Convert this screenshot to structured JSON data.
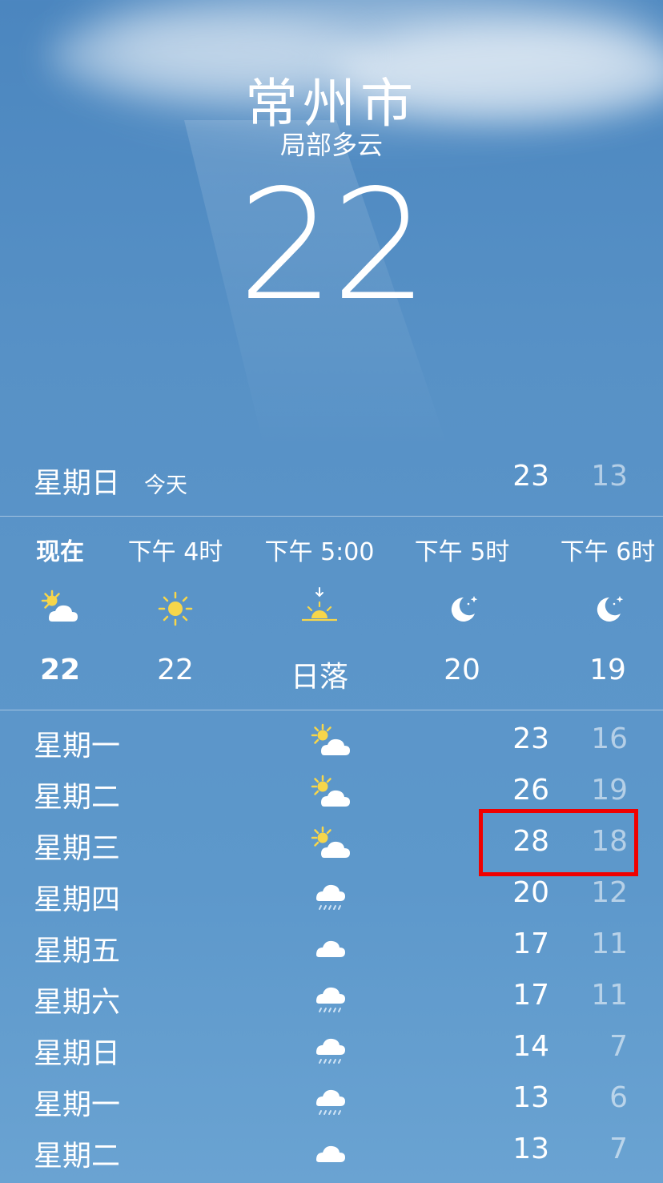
{
  "location": {
    "city": "常州市",
    "condition": "局部多云",
    "temperature": "22"
  },
  "today": {
    "day": "星期日",
    "tag": "今天",
    "high": "23",
    "low": "13"
  },
  "hourly": [
    {
      "label": "现在",
      "icon": "partly-cloudy-icon",
      "temp": "22",
      "bold": true
    },
    {
      "label": "下午 4时",
      "icon": "sun-icon",
      "temp": "22"
    },
    {
      "label": "下午 5:00",
      "icon": "sunset-icon",
      "temp": "日落"
    },
    {
      "label": "下午 5时",
      "icon": "moon-icon",
      "temp": "20"
    },
    {
      "label": "下午 6时",
      "icon": "moon-icon",
      "temp": "19"
    }
  ],
  "daily": [
    {
      "day": "星期一",
      "icon": "partly-cloudy-icon",
      "high": "23",
      "low": "16"
    },
    {
      "day": "星期二",
      "icon": "partly-cloudy-icon",
      "high": "26",
      "low": "19"
    },
    {
      "day": "星期三",
      "icon": "partly-cloudy-icon",
      "high": "28",
      "low": "18"
    },
    {
      "day": "星期四",
      "icon": "rain-icon",
      "high": "20",
      "low": "12"
    },
    {
      "day": "星期五",
      "icon": "cloud-icon",
      "high": "17",
      "low": "11"
    },
    {
      "day": "星期六",
      "icon": "rain-icon",
      "high": "17",
      "low": "11"
    },
    {
      "day": "星期日",
      "icon": "rain-icon",
      "high": "14",
      "low": "7"
    },
    {
      "day": "星期一",
      "icon": "rain-icon",
      "high": "13",
      "low": "6"
    },
    {
      "day": "星期二",
      "icon": "cloud-icon",
      "high": "13",
      "low": "7"
    }
  ],
  "colors": {
    "sun": "#f7d64a",
    "highlight": "#f00000"
  }
}
